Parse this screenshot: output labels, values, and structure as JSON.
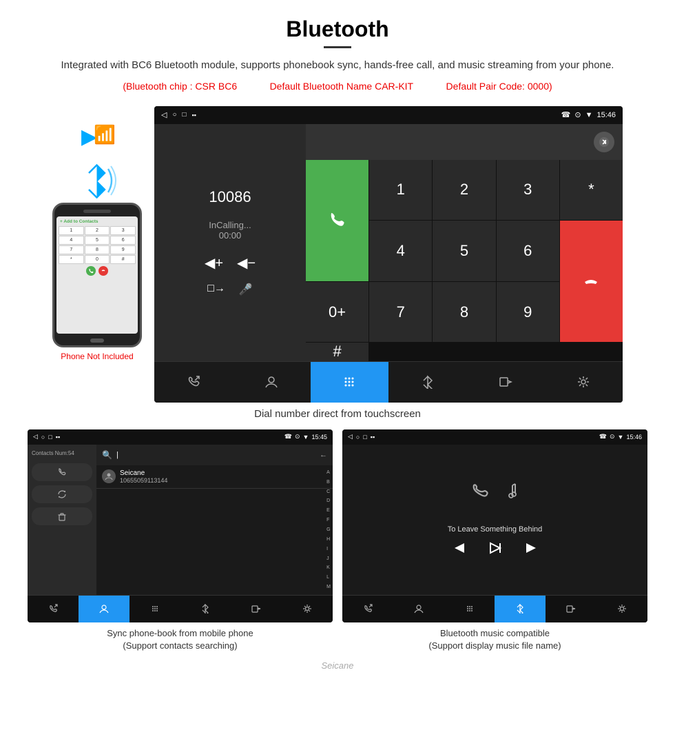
{
  "header": {
    "title": "Bluetooth",
    "description": "Integrated with BC6 Bluetooth module, supports phonebook sync, hands-free call, and music streaming from your phone.",
    "specs": {
      "chip": "(Bluetooth chip : CSR BC6",
      "name": "Default Bluetooth Name CAR-KIT",
      "pair": "Default Pair Code: 0000)"
    }
  },
  "dial_screen": {
    "status_bar": {
      "time": "15:46",
      "icons_left": [
        "◁",
        "○",
        "□",
        "▪▪"
      ],
      "icons_right": [
        "☎",
        "⊙",
        "▼",
        "15:46"
      ]
    },
    "left_panel": {
      "number": "10086",
      "status": "InCalling...",
      "timer": "00:00",
      "vol_up": "◀+",
      "vol_down": "◀−",
      "transfer": "□→",
      "mic": "🎤"
    },
    "keypad": {
      "rows": [
        [
          "1",
          "2",
          "3",
          "*",
          "📞"
        ],
        [
          "4",
          "5",
          "6",
          "0+",
          "📞"
        ],
        [
          "7",
          "8",
          "9",
          "#",
          "📞"
        ]
      ]
    },
    "nav_bar": {
      "items": [
        "☎↗",
        "👤",
        "⠿",
        "✱",
        "□→",
        "⚙"
      ]
    },
    "caption": "Dial number direct from touchscreen"
  },
  "phonebook_screen": {
    "status_bar": {
      "time": "15:45",
      "icons_left": [
        "◁",
        "○",
        "□",
        "▪▪"
      ],
      "icons_right": [
        "☎",
        "⊙",
        "▼",
        "15:45"
      ]
    },
    "left_panel": {
      "contacts_num": "Contacts Num:54",
      "buttons": [
        "☎",
        "↺",
        "🗑"
      ]
    },
    "search": {
      "placeholder": "|",
      "back_icon": "←"
    },
    "contact": {
      "name": "Seicane",
      "number": "10655059113144"
    },
    "alpha": [
      "A",
      "B",
      "C",
      "D",
      "E",
      "F",
      "G",
      "H",
      "I",
      "J",
      "K",
      "L",
      "M"
    ],
    "nav_bar": {
      "items": [
        "☎↗",
        "👤",
        "⠿",
        "✱",
        "□→",
        "⚙"
      ],
      "active_index": 1
    },
    "caption_line1": "Sync phone-book from mobile phone",
    "caption_line2": "(Support contacts searching)"
  },
  "music_screen": {
    "status_bar": {
      "time": "15:46",
      "icons_left": [
        "◁",
        "○",
        "□",
        "▪▪"
      ],
      "icons_right": [
        "☎",
        "⊙",
        "▼",
        "15:46"
      ]
    },
    "song_title": "To Leave Something Behind",
    "controls": [
      "⏮",
      "⏭",
      "⏭"
    ],
    "nav_bar": {
      "items": [
        "☎↗",
        "👤",
        "⠿",
        "✱",
        "□→",
        "⚙"
      ],
      "active_index": 3
    },
    "caption_line1": "Bluetooth music compatible",
    "caption_line2": "(Support display music file name)"
  },
  "phone_mockup": {
    "label": "Phone Not Included",
    "keypad_keys": [
      "1",
      "2",
      "3",
      "4",
      "5",
      "6",
      "7",
      "8",
      "9",
      "*",
      "0",
      "#"
    ]
  },
  "watermark": "Seicane"
}
